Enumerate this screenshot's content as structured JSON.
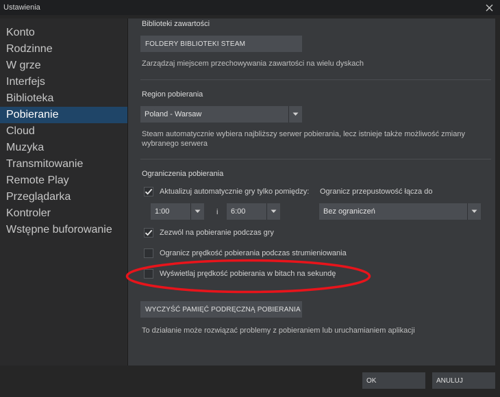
{
  "window": {
    "title": "Ustawienia"
  },
  "sidebar": {
    "items": [
      {
        "label": "Konto",
        "active": false
      },
      {
        "label": "Rodzinne",
        "active": false
      },
      {
        "label": "W grze",
        "active": false
      },
      {
        "label": "Interfejs",
        "active": false
      },
      {
        "label": "Biblioteka",
        "active": false
      },
      {
        "label": "Pobieranie",
        "active": true
      },
      {
        "label": "Cloud",
        "active": false
      },
      {
        "label": "Muzyka",
        "active": false
      },
      {
        "label": "Transmitowanie",
        "active": false
      },
      {
        "label": "Remote Play",
        "active": false
      },
      {
        "label": "Przeglądarka",
        "active": false
      },
      {
        "label": "Kontroler",
        "active": false
      },
      {
        "label": "Wstępne buforowanie",
        "active": false
      }
    ]
  },
  "library": {
    "title": "Biblioteki zawartości",
    "button": "FOLDERY BIBLIOTEKI STEAM",
    "desc": "Zarządzaj miejscem przechowywania zawartości na wielu dyskach"
  },
  "region": {
    "title": "Region pobierania",
    "value": "Poland - Warsaw",
    "desc_line1": "Steam automatycznie wybiera najbliższy serwer pobierania, lecz istnieje także możliwość zmiany",
    "desc_line2": "wybranego serwera"
  },
  "limits": {
    "title": "Ograniczenia pobierania",
    "auto_update_label": "Aktualizuj automatycznie gry tylko pomiędzy:",
    "auto_update_checked": true,
    "time_from": "1:00",
    "time_and": "i",
    "time_to": "6:00",
    "bandwidth_label": "Ogranicz przepustowość łącza do",
    "bandwidth_value": "Bez ograniczeń",
    "allow_ingame_label": "Zezwól na pobieranie podczas gry",
    "allow_ingame_checked": true,
    "throttle_stream_label": "Ogranicz prędkość pobierania podczas strumieniowania",
    "throttle_stream_checked": false,
    "bits_label": "Wyświetlaj prędkość pobierania w bitach na sekundę",
    "bits_checked": false
  },
  "cache": {
    "button": "WYCZYŚĆ PAMIĘĆ PODRĘCZNĄ POBIERANIA",
    "desc": "To działanie może rozwiązać problemy z pobieraniem lub uruchamianiem aplikacji"
  },
  "footer": {
    "ok": "OK",
    "cancel": "ANULUJ"
  },
  "colors": {
    "active_item": "#1f4568",
    "annotation": "#e8141b",
    "panel": "#383a3d",
    "button": "#4a4d52"
  }
}
